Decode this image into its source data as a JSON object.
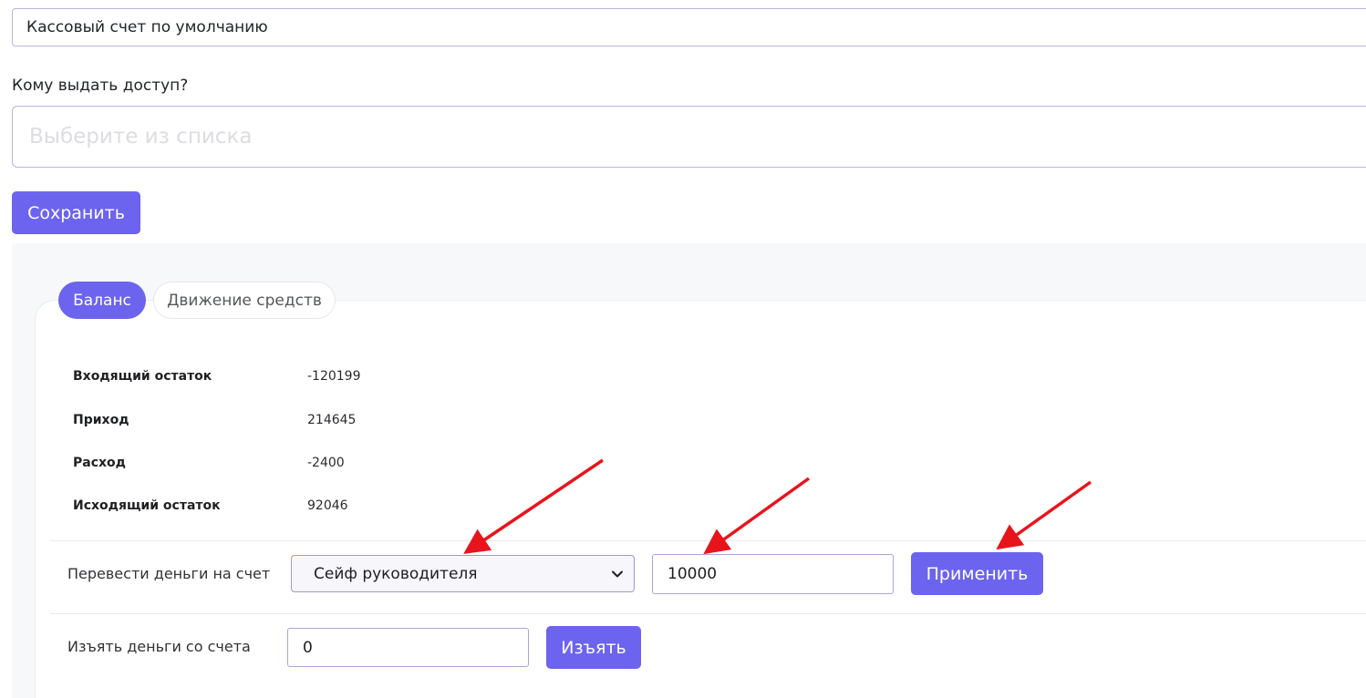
{
  "account": {
    "default_account": "Кассовый счет по умолчанию"
  },
  "access": {
    "label": "Кому выдать доступ?",
    "placeholder": "Выберите из списка"
  },
  "save_label": "Сохранить",
  "tabs": [
    {
      "label": "Баланс",
      "active": true
    },
    {
      "label": "Движение средств",
      "active": false
    }
  ],
  "balance": [
    {
      "label": "Входящий остаток",
      "value": "-120199"
    },
    {
      "label": "Приход",
      "value": "214645"
    },
    {
      "label": "Расход",
      "value": "-2400"
    },
    {
      "label": "Исходящий остаток",
      "value": "92046"
    }
  ],
  "transfer": {
    "label": "Перевести деньги на счет",
    "selected_account": "Сейф руководителя",
    "amount": "10000",
    "apply_label": "Применить"
  },
  "withdraw": {
    "label": "Изъять деньги со счета",
    "amount": "0",
    "button_label": "Изъять"
  },
  "colors": {
    "accent": "#6c63ee",
    "annotation_arrow": "#e8141c"
  },
  "icons": {
    "select_caret": "chevron-down-icon"
  }
}
